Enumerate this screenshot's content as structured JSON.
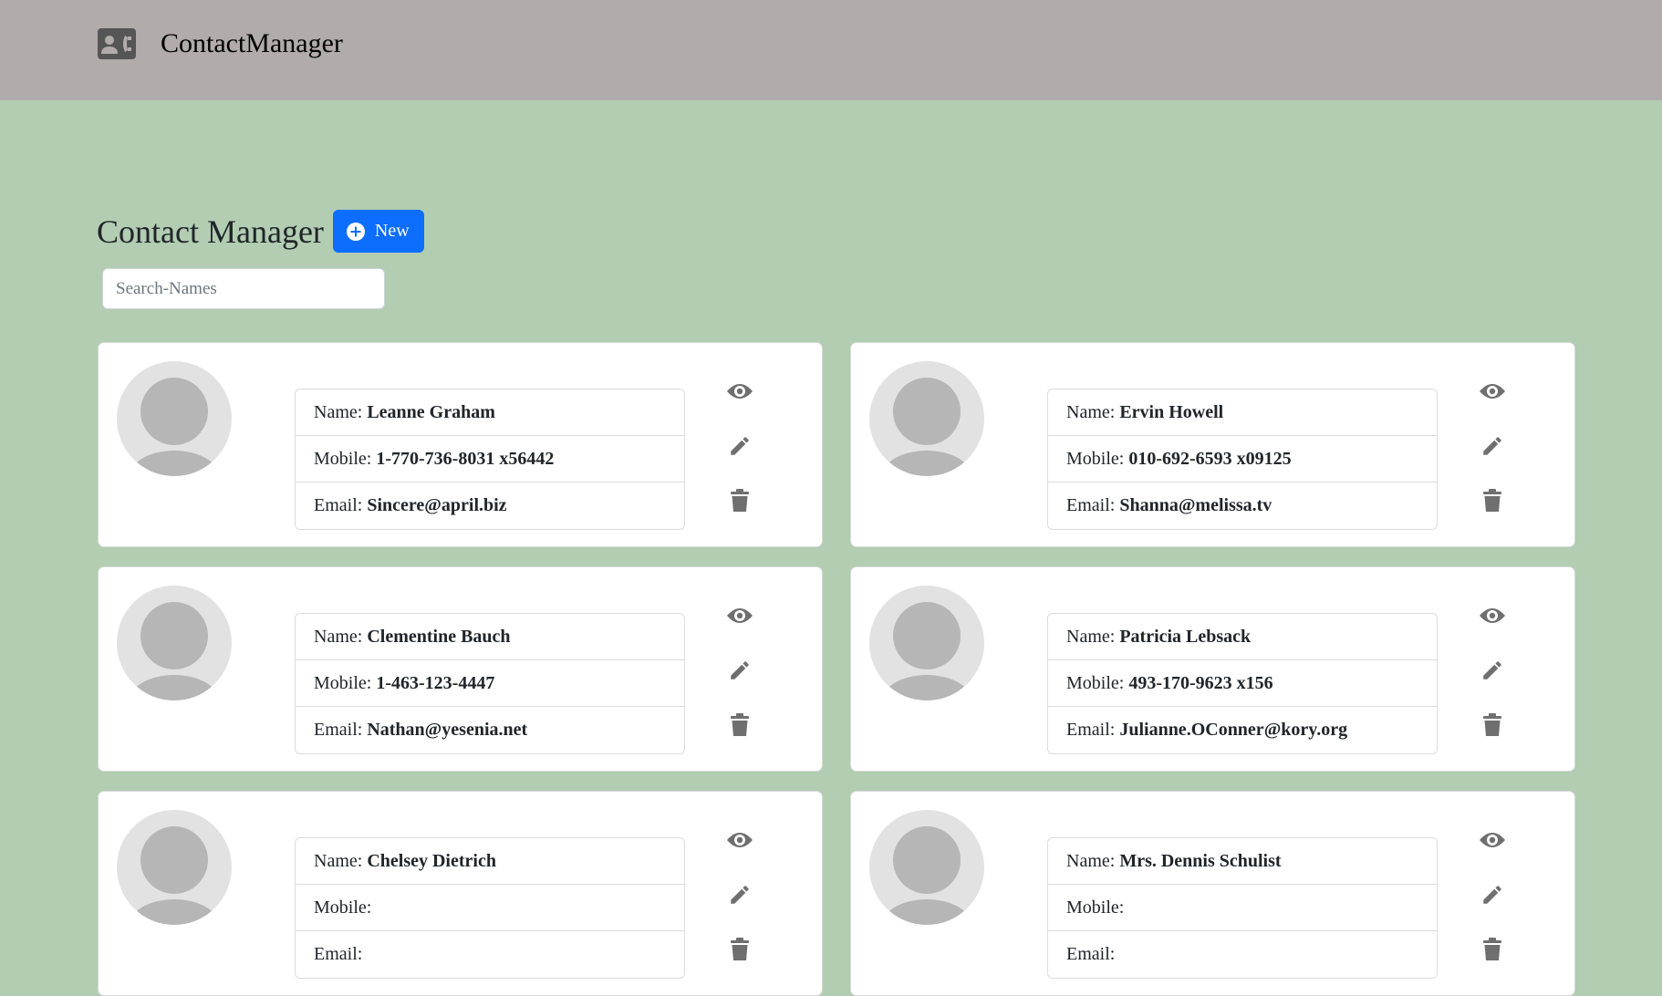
{
  "navbar": {
    "brand": "ContactManager",
    "icon": "contact-phone-icon"
  },
  "page": {
    "title": "Contact Manager",
    "new_label": "New"
  },
  "search": {
    "placeholder": "Search-Names",
    "value": ""
  },
  "labels": {
    "name": "Name:",
    "mobile": "Mobile:",
    "email": "Email:"
  },
  "contacts": [
    {
      "name": "Leanne Graham",
      "mobile": "1-770-736-8031 x56442",
      "email": "Sincere@april.biz"
    },
    {
      "name": "Ervin Howell",
      "mobile": "010-692-6593 x09125",
      "email": "Shanna@melissa.tv"
    },
    {
      "name": "Clementine Bauch",
      "mobile": "1-463-123-4447",
      "email": "Nathan@yesenia.net"
    },
    {
      "name": "Patricia Lebsack",
      "mobile": "493-170-9623 x156",
      "email": "Julianne.OConner@kory.org"
    },
    {
      "name": "Chelsey Dietrich",
      "mobile": "",
      "email": ""
    },
    {
      "name": "Mrs. Dennis Schulist",
      "mobile": "",
      "email": ""
    }
  ],
  "colors": {
    "navbar": "#b2abab",
    "background": "#b2cdb2",
    "primary": "#0d6efd",
    "icon": "#6f6f6f"
  }
}
